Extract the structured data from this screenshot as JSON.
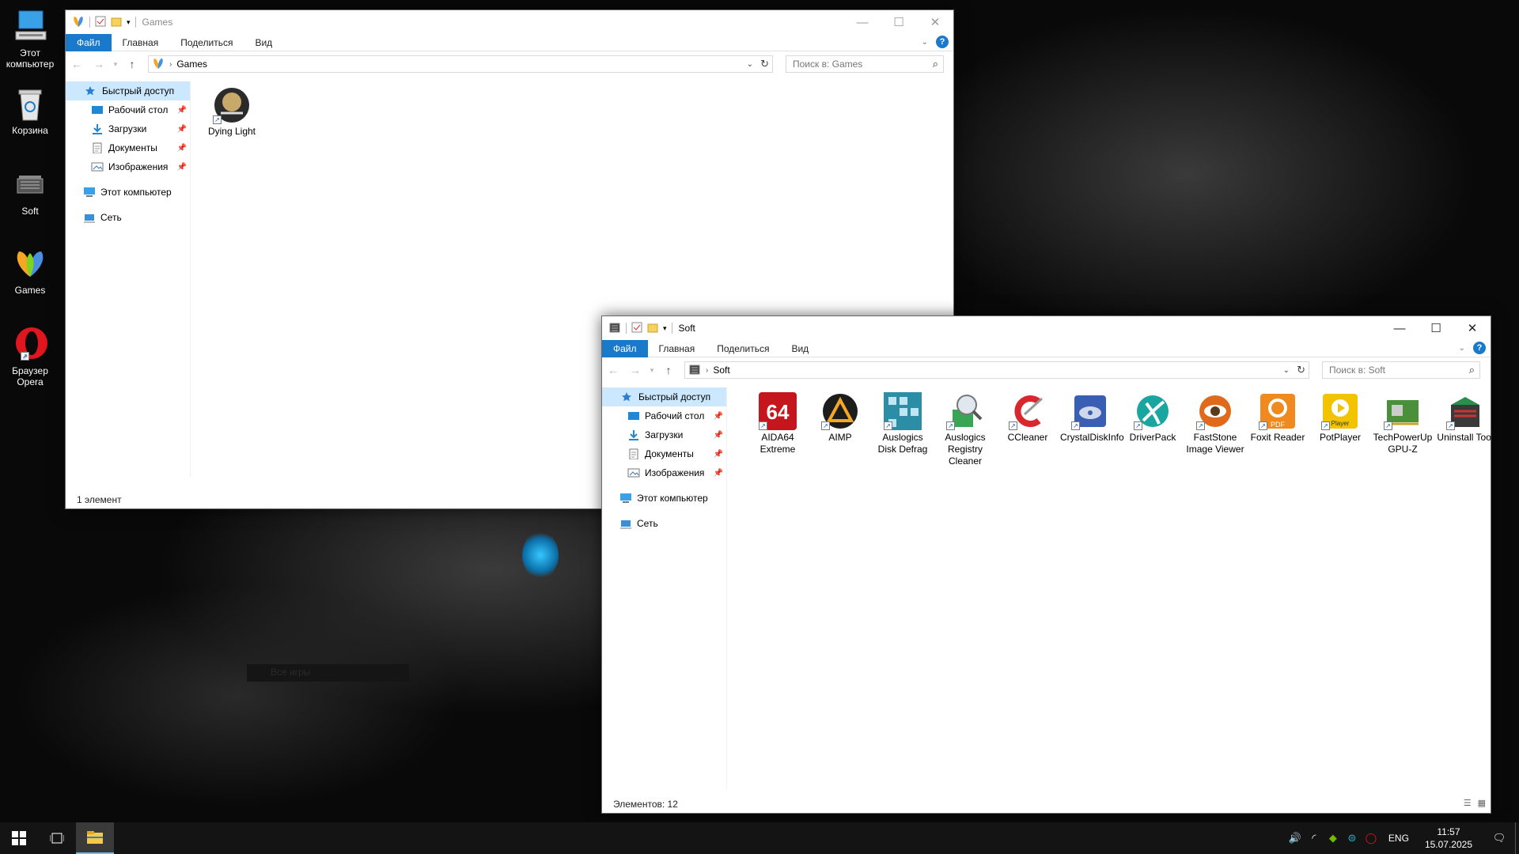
{
  "desktop": {
    "icons": [
      {
        "label": "Этот компьютер",
        "icon": "this-pc-icon"
      },
      {
        "label": "Корзина",
        "icon": "recycle-bin-icon"
      },
      {
        "label": "Soft",
        "icon": "folder-soft-icon"
      },
      {
        "label": "Games",
        "icon": "folder-games-icon"
      },
      {
        "label": "Браузер Opera",
        "icon": "opera-icon"
      }
    ],
    "ghost_text": "Все игры"
  },
  "games_window": {
    "title": "Games",
    "ribbon_tabs": [
      "Файл",
      "Главная",
      "Поделиться",
      "Вид"
    ],
    "address": "Games",
    "search_placeholder": "Поиск в: Games",
    "nav": {
      "quick_access": "Быстрый доступ",
      "desktop": "Рабочий стол",
      "downloads": "Загрузки",
      "documents": "Документы",
      "pictures": "Изображения",
      "this_pc": "Этот компьютер",
      "network": "Сеть"
    },
    "files": [
      {
        "label": "Dying Light",
        "icon": "dying-light-icon"
      }
    ],
    "status": "1 элемент"
  },
  "soft_window": {
    "title": "Soft",
    "ribbon_tabs": [
      "Файл",
      "Главная",
      "Поделиться",
      "Вид"
    ],
    "address": "Soft",
    "search_placeholder": "Поиск в: Soft",
    "nav": {
      "quick_access": "Быстрый доступ",
      "desktop": "Рабочий стол",
      "downloads": "Загрузки",
      "documents": "Документы",
      "pictures": "Изображения",
      "this_pc": "Этот компьютер",
      "network": "Сеть"
    },
    "files": [
      {
        "label": "AIDA64 Extreme",
        "icon": "aida64-icon",
        "color": "#c4161c"
      },
      {
        "label": "AIMP",
        "icon": "aimp-icon",
        "color": "#1c1c1c"
      },
      {
        "label": "Auslogics Disk Defrag",
        "icon": "disk-defrag-icon",
        "color": "#2b8ea6"
      },
      {
        "label": "Auslogics Registry Cleaner",
        "icon": "registry-cleaner-icon",
        "color": "#3aa655"
      },
      {
        "label": "CCleaner",
        "icon": "ccleaner-icon",
        "color": "#d9272e"
      },
      {
        "label": "CrystalDiskInfo",
        "icon": "crystaldiskinfo-icon",
        "color": "#3b5eb5"
      },
      {
        "label": "DriverPack",
        "icon": "driverpack-icon",
        "color": "#1aa6a0"
      },
      {
        "label": "FastStone Image Viewer",
        "icon": "faststone-icon",
        "color": "#e06a1b"
      },
      {
        "label": "Foxit Reader",
        "icon": "foxit-icon",
        "color": "#f08a1e"
      },
      {
        "label": "PotPlayer",
        "icon": "potplayer-icon",
        "color": "#f2c400"
      },
      {
        "label": "TechPowerUp GPU-Z",
        "icon": "gpuz-icon",
        "color": "#4a8f3a"
      },
      {
        "label": "Uninstall Tool",
        "icon": "uninstall-tool-icon",
        "color": "#3a3a3a"
      }
    ],
    "status": "Элементов: 12"
  },
  "taskbar": {
    "language": "ENG",
    "time": "11:57",
    "date": "15.07.2025"
  }
}
